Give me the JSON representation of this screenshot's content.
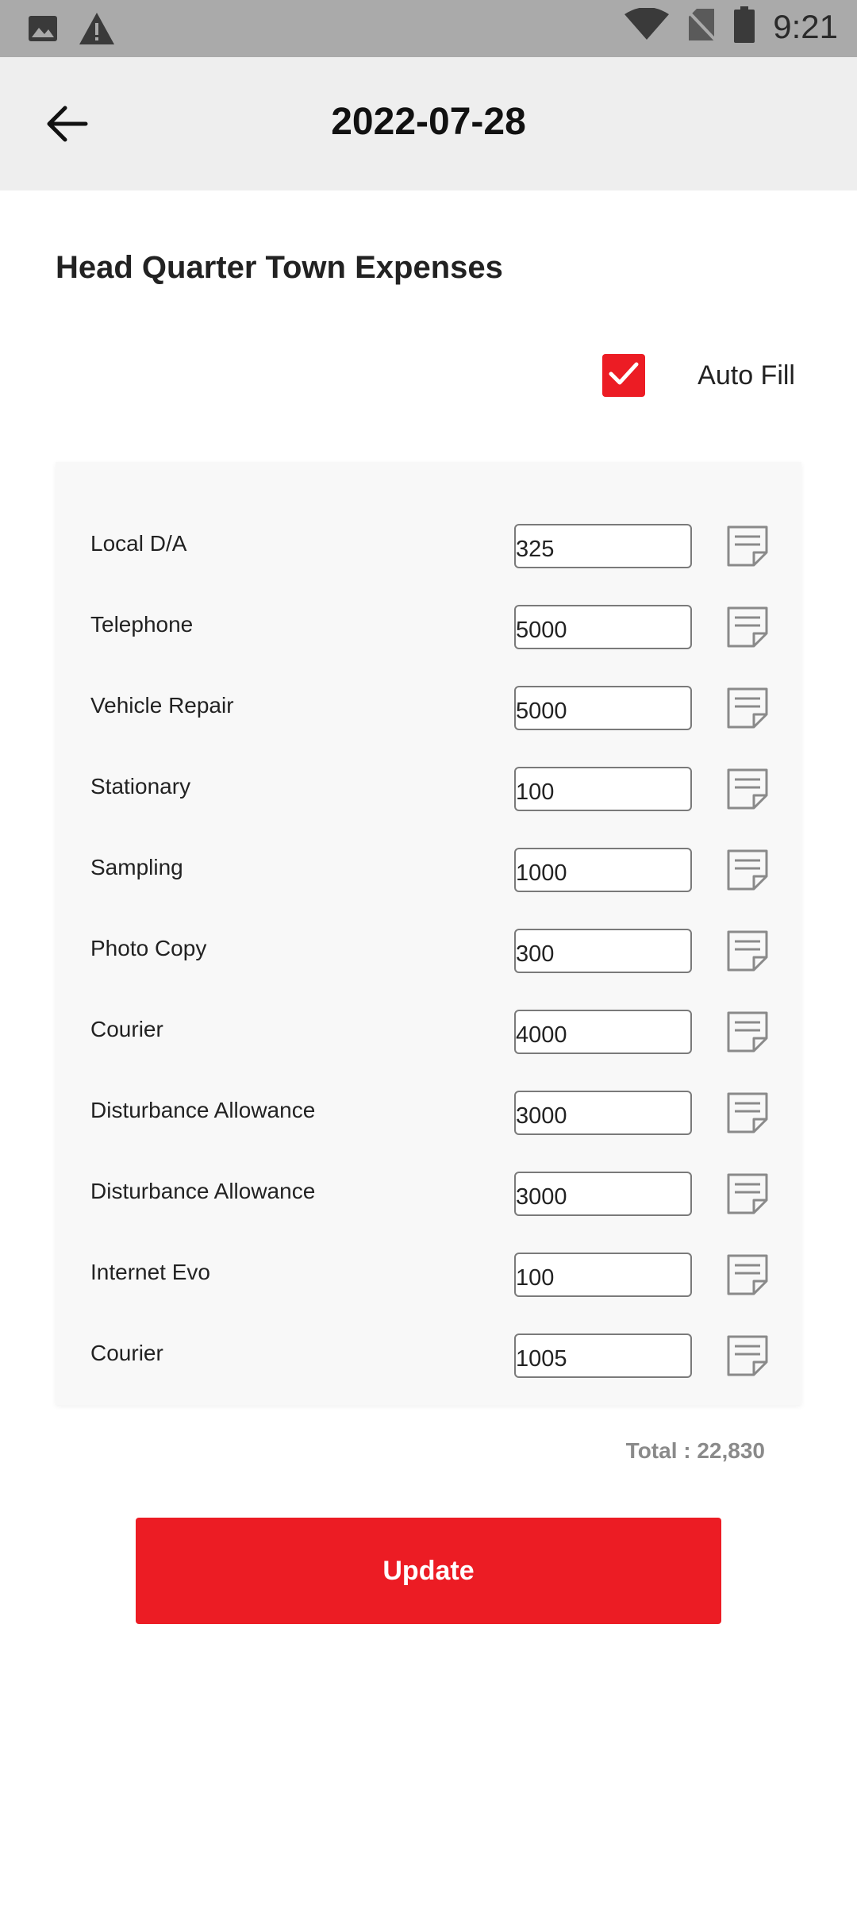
{
  "status_bar": {
    "time": "9:21",
    "icons": [
      "image-icon",
      "warning-icon",
      "wifi-icon",
      "no-sim-icon",
      "battery-icon"
    ]
  },
  "header": {
    "title": "2022-07-28",
    "back_icon": "arrow-left-icon"
  },
  "section": {
    "title": "Head Quarter Town Expenses"
  },
  "autofill": {
    "label": "Auto Fill",
    "checked": true
  },
  "expenses": [
    {
      "label": "Local D/A",
      "value": "325"
    },
    {
      "label": "Telephone",
      "value": "5000"
    },
    {
      "label": "Vehicle Repair",
      "value": "5000"
    },
    {
      "label": "Stationary",
      "value": "100"
    },
    {
      "label": "Sampling",
      "value": "1000"
    },
    {
      "label": "Photo Copy",
      "value": "300"
    },
    {
      "label": "Courier",
      "value": "4000"
    },
    {
      "label": "Disturbance Allowance",
      "value": "3000"
    },
    {
      "label": "Disturbance Allowance",
      "value": "3000"
    },
    {
      "label": "Internet Evo",
      "value": "100"
    },
    {
      "label": "Courier",
      "value": "1005"
    }
  ],
  "total": "Total : 22,830",
  "update_button": "Update",
  "colors": {
    "accent": "#ec1c24",
    "status_bar": "#aaaaaa",
    "app_bar": "#eeeeee",
    "card": "#f8f8f8"
  }
}
